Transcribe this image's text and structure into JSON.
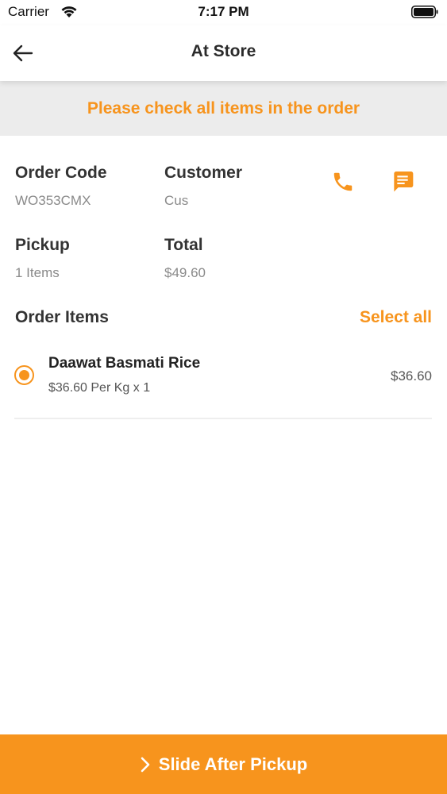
{
  "status_bar": {
    "carrier": "Carrier",
    "time": "7:17 PM"
  },
  "nav": {
    "title": "At Store"
  },
  "banner": {
    "message": "Please check all items in the order"
  },
  "order": {
    "code_label": "Order Code",
    "code_value": "WO353CMX",
    "customer_label": "Customer",
    "customer_value": "Cus",
    "pickup_label": "Pickup",
    "pickup_value": "1 Items",
    "total_label": "Total",
    "total_value": "$49.60"
  },
  "items_section": {
    "title": "Order Items",
    "select_all": "Select all",
    "items": [
      {
        "name": "Daawat Basmati Rice",
        "detail": "$36.60 Per Kg x 1",
        "price": "$36.60",
        "selected": true
      }
    ]
  },
  "footer": {
    "slide_label": "Slide After Pickup"
  },
  "colors": {
    "accent": "#f7941d",
    "banner_bg": "#ececec"
  },
  "icons": [
    "wifi-icon",
    "battery-icon",
    "back-arrow-icon",
    "phone-icon",
    "chat-icon",
    "chevron-right-icon"
  ]
}
